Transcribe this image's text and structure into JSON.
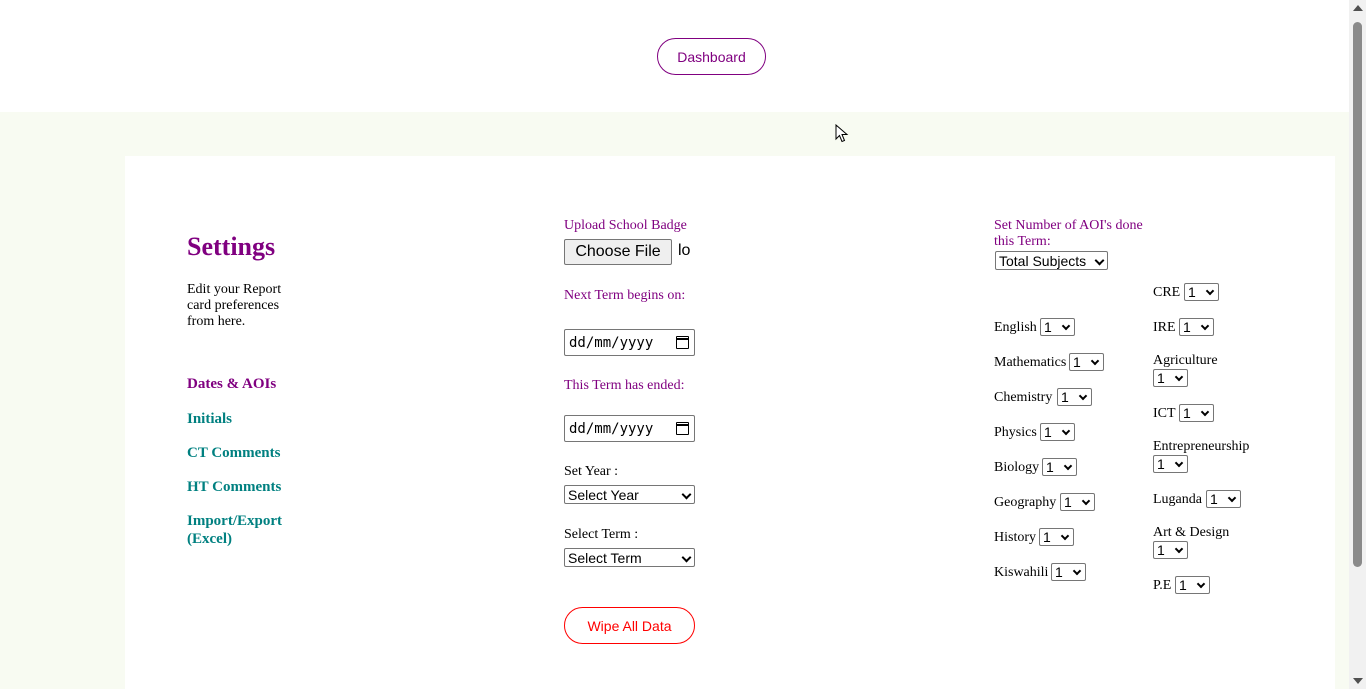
{
  "header": {
    "dashboard_label": "Dashboard"
  },
  "sidebar": {
    "title": "Settings",
    "description": "Edit your Report card preferences from here.",
    "items": [
      {
        "label": "Dates & AOIs"
      },
      {
        "label": "Initials"
      },
      {
        "label": "CT Comments"
      },
      {
        "label": "HT Comments"
      },
      {
        "label": "Import/Export (Excel)"
      }
    ]
  },
  "form": {
    "upload_label": "Upload School Badge",
    "choose_file_label": "Choose File",
    "file_status": "lo",
    "next_term_label": "Next Term begins on:",
    "next_term_value": "dd/mm/yyyy",
    "term_ended_label": "This Term has ended:",
    "term_ended_value": "dd/mm/yyyy",
    "set_year_label": "Set Year :",
    "set_year_value": "Select Year",
    "select_term_label": "Select Term :",
    "select_term_value": "Select Term",
    "wipe_label": "Wipe All Data"
  },
  "aoi": {
    "title": "Set Number of AOI's done this Term:",
    "total_subjects_value": "Total Subjects",
    "left_subjects": [
      {
        "name": "English",
        "value": "1"
      },
      {
        "name": "Mathematics",
        "value": "1"
      },
      {
        "name": "Chemistry",
        "value": "1"
      },
      {
        "name": "Physics",
        "value": "1"
      },
      {
        "name": "Biology",
        "value": "1"
      },
      {
        "name": "Geography",
        "value": "1"
      },
      {
        "name": "History",
        "value": "1"
      },
      {
        "name": "Kiswahili",
        "value": "1"
      }
    ],
    "right_subjects": [
      {
        "name": "CRE",
        "value": "1"
      },
      {
        "name": "IRE",
        "value": "1"
      },
      {
        "name": "Agriculture",
        "value": "1"
      },
      {
        "name": "ICT",
        "value": "1"
      },
      {
        "name": "Entrepreneurship",
        "value": "1"
      },
      {
        "name": "Luganda",
        "value": "1"
      },
      {
        "name": "Art & Design",
        "value": "1"
      },
      {
        "name": "P.E",
        "value": "1"
      }
    ]
  },
  "colors": {
    "accent": "#800080",
    "nav": "#008080",
    "danger": "#ff0000",
    "band": "#f8fbf2"
  }
}
